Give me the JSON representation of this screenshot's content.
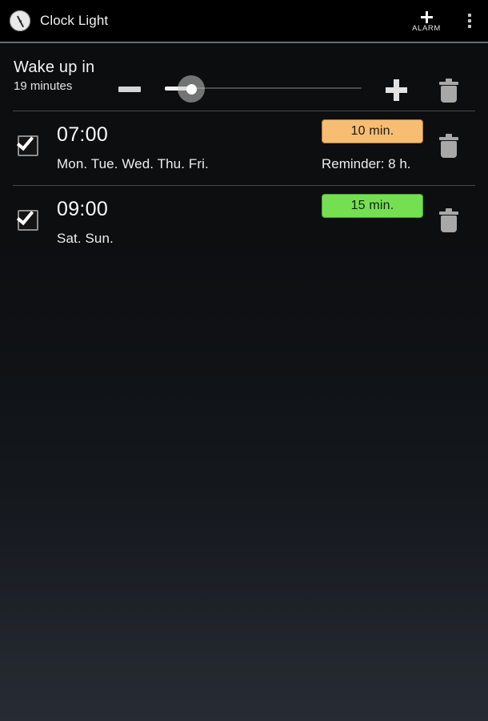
{
  "header": {
    "app_icon": "clock-icon",
    "title": "Clock Light",
    "add_alarm": {
      "icon": "plus-icon",
      "label": "ALARM"
    },
    "overflow": {
      "icon": "overflow-menu-icon"
    }
  },
  "wake_section": {
    "title": "Wake up in",
    "value": "19 minutes",
    "decrease": {
      "icon": "minus-icon"
    },
    "increase": {
      "icon": "plus-icon"
    },
    "delete": {
      "icon": "trash-icon"
    },
    "slider": {
      "percent": 13,
      "fill_color": "#f2f2f2",
      "track_color": "#4b4b4b"
    }
  },
  "alarms": [
    {
      "enabled": true,
      "time": "07:00",
      "days": "Mon. Tue. Wed. Thu. Fri.",
      "badge_label": "10 min.",
      "badge_color": "#f7bd72",
      "badge_border": "#b17c33",
      "reminder": "Reminder: 8 h.",
      "delete_icon": "trash-icon",
      "checkbox_icon": "checkbox-checked-icon"
    },
    {
      "enabled": true,
      "time": "09:00",
      "days": "Sat. Sun.",
      "badge_label": "15 min.",
      "badge_color": "#74e051",
      "badge_border": "#4aa032",
      "reminder": "",
      "delete_icon": "trash-icon",
      "checkbox_icon": "checkbox-checked-icon"
    }
  ],
  "theme": {
    "background_top": "#0c0d0f",
    "background_bottom": "#272b33",
    "header_background": "#000000",
    "divider": "#494949",
    "text_primary": "#fafafa",
    "text_secondary": "#ededed"
  }
}
